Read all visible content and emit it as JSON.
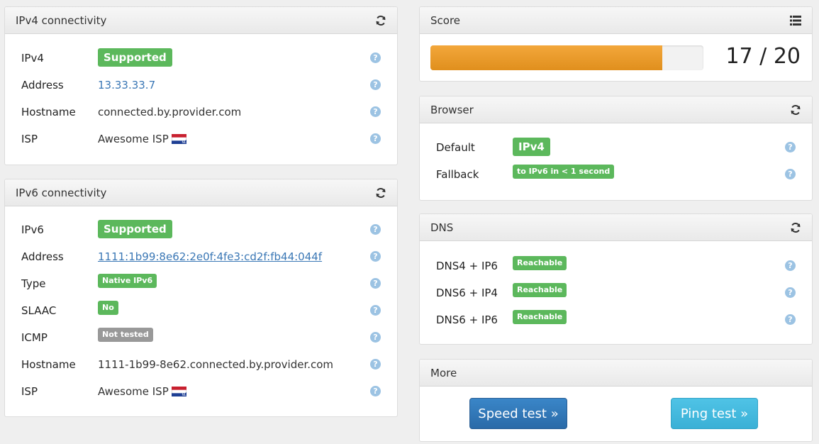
{
  "ipv4": {
    "title": "IPv4 connectivity",
    "rows": {
      "ipv4": {
        "label": "IPv4",
        "value": "Supported"
      },
      "address": {
        "label": "Address",
        "value": "13.33.33.7"
      },
      "hostname": {
        "label": "Hostname",
        "value": "connected.by.provider.com"
      },
      "isp": {
        "label": "ISP",
        "value": "Awesome ISP"
      }
    }
  },
  "ipv6": {
    "title": "IPv6 connectivity",
    "rows": {
      "ipv6": {
        "label": "IPv6",
        "value": "Supported"
      },
      "address": {
        "label": "Address",
        "value": "1111:1b99:8e62:2e0f:4fe3:cd2f:fb44:044f"
      },
      "type": {
        "label": "Type",
        "value": "Native IPv6"
      },
      "slaac": {
        "label": "SLAAC",
        "value": "No"
      },
      "icmp": {
        "label": "ICMP",
        "value": "Not tested"
      },
      "hostname": {
        "label": "Hostname",
        "value": "1111-1b99-8e62.connected.by.provider.com"
      },
      "isp": {
        "label": "ISP",
        "value": "Awesome ISP"
      }
    }
  },
  "score": {
    "title": "Score",
    "text": "17 / 20",
    "value": 17,
    "max": 20,
    "bar_color": "#ec9a2a"
  },
  "browser": {
    "title": "Browser",
    "rows": {
      "default": {
        "label": "Default",
        "value": "IPv4"
      },
      "fallback": {
        "label": "Fallback",
        "value": "to IPv6 in < 1 second"
      }
    }
  },
  "dns": {
    "title": "DNS",
    "rows": [
      {
        "label": "DNS4 + IP6",
        "value": "Reachable"
      },
      {
        "label": "DNS6 + IP4",
        "value": "Reachable"
      },
      {
        "label": "DNS6 + IP6",
        "value": "Reachable"
      }
    ]
  },
  "more": {
    "title": "More",
    "speed_test": "Speed test »",
    "ping_test": "Ping test »"
  },
  "help_symbol": "?",
  "icons": {
    "refresh": "refresh-icon",
    "list": "list-icon",
    "help": "help-icon",
    "flag": "netherlands-flag-icon"
  },
  "colors": {
    "success": "#5cb85c",
    "muted": "#999999",
    "link": "#3a77b5",
    "help": "#9cc3e3"
  }
}
